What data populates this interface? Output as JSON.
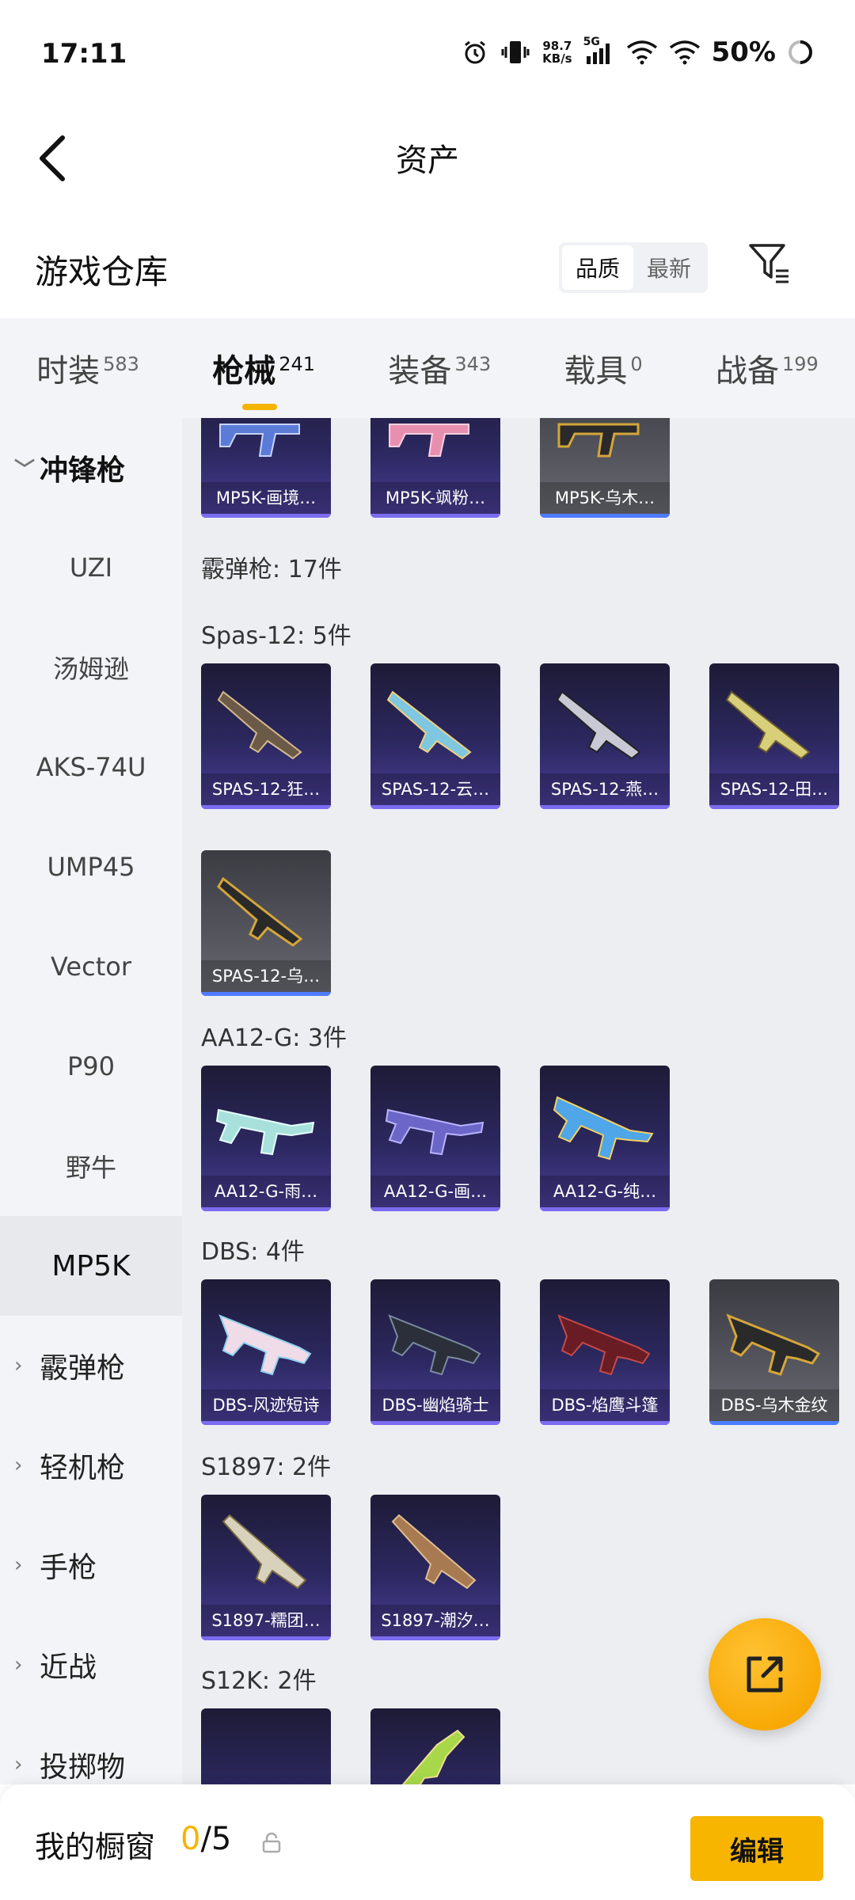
{
  "status_bar": {
    "time": "17:11",
    "net_speed_value": "98.7",
    "net_speed_unit": "KB/s",
    "network": "5G",
    "battery": "50%"
  },
  "header": {
    "title": "资产"
  },
  "warehouse": {
    "title": "游戏仓库",
    "sort_options": [
      "品质",
      "最新"
    ],
    "active_sort": "品质"
  },
  "tabs": [
    {
      "label": "时装",
      "count": "583"
    },
    {
      "label": "枪械",
      "count": "241",
      "active": true
    },
    {
      "label": "装备",
      "count": "343"
    },
    {
      "label": "载具",
      "count": "0"
    },
    {
      "label": "战备",
      "count": "199"
    }
  ],
  "sidebar": {
    "items": [
      {
        "label": "冲锋枪",
        "type": "category",
        "expanded": true
      },
      {
        "label": "UZI"
      },
      {
        "label": "汤姆逊"
      },
      {
        "label": "AKS-74U"
      },
      {
        "label": "UMP45"
      },
      {
        "label": "Vector"
      },
      {
        "label": "P90"
      },
      {
        "label": "野牛"
      },
      {
        "label": "MP5K",
        "selected": true
      },
      {
        "label": "霰弹枪",
        "type": "category"
      },
      {
        "label": "轻机枪",
        "type": "category"
      },
      {
        "label": "手枪",
        "type": "category"
      },
      {
        "label": "近战",
        "type": "category"
      },
      {
        "label": "投掷物",
        "type": "category"
      }
    ]
  },
  "content": {
    "mp5k_items": [
      "MP5K-画境…",
      "MP5K-飒粉…",
      "MP5K-乌木…"
    ],
    "shotgun_header": "霰弹枪: 17件",
    "sections": [
      {
        "label": "Spas-12: 5件",
        "items": [
          "SPAS-12-狂…",
          "SPAS-12-云…",
          "SPAS-12-燕…",
          "SPAS-12-田…",
          "SPAS-12-乌…"
        ]
      },
      {
        "label": "AA12-G: 3件",
        "items": [
          "AA12-G-雨…",
          "AA12-G-画…",
          "AA12-G-纯…"
        ]
      },
      {
        "label": "DBS: 4件",
        "items": [
          "DBS-风迹短诗",
          "DBS-幽焰骑士",
          "DBS-焰鹰斗篷",
          "DBS-乌木金纹"
        ]
      },
      {
        "label": "S1897: 2件",
        "items": [
          "S1897-糯团…",
          "S1897-潮汐…"
        ]
      },
      {
        "label": "S12K: 2件",
        "items": [
          "",
          ""
        ]
      }
    ]
  },
  "bottom_bar": {
    "title": "我的橱窗",
    "used": "0",
    "sep_total": "/5",
    "edit_label": "编辑"
  },
  "colors": {
    "accent": "#f5b400",
    "card_purple": "#2c2860",
    "card_grey": "#55565e",
    "page_bg": "#eceef2"
  },
  "icons": [
    "back-arrow-icon",
    "filter-icon",
    "share-icon",
    "lock-icon",
    "alarm-icon",
    "vibrate-icon",
    "signal-icon",
    "wifi-icon",
    "battery-icon"
  ]
}
